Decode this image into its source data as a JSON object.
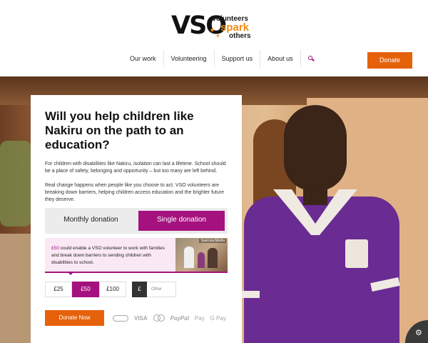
{
  "header": {
    "logo_letters": "VSO",
    "logo_tag": [
      "Volunteers",
      "spark",
      "others"
    ],
    "nav": [
      "Our work",
      "Volunteering",
      "Support us",
      "About us"
    ],
    "search_icon": "search-icon",
    "donate_label": "Donate"
  },
  "hero": {
    "title": "Will you help children like Nakiru on the path to an education?",
    "para1": "For children with disabilities like Nakiru, isolation can last a lifetime. School should be a place of safety, belonging and opportunity – but too many are left behind.",
    "para2": "Real change happens when people like you choose to act. VSO volunteers are breaking down barriers, helping children access education and the brighter future they deserve."
  },
  "donation": {
    "tabs": [
      "Monthly donation",
      "Single donation"
    ],
    "active_tab": 1,
    "info_amount": "£50",
    "info_text": " could enable a VSO volunteer to work with families and break down barriers to sending children with disabilities to school.",
    "photo_caption": "Sparosa Media",
    "amounts": [
      "£25",
      "£50",
      "£100"
    ],
    "selected_amount": 1,
    "currency_symbol": "£",
    "other_placeholder": "Other",
    "donate_now_label": "Donate Now",
    "payment_methods": [
      "Direct Debit",
      "VISA",
      "MasterCard",
      "PayPal",
      "Apple Pay",
      "G Pay"
    ]
  },
  "colors": {
    "brand_magenta": "#a5127f",
    "brand_orange": "#e5620b"
  }
}
